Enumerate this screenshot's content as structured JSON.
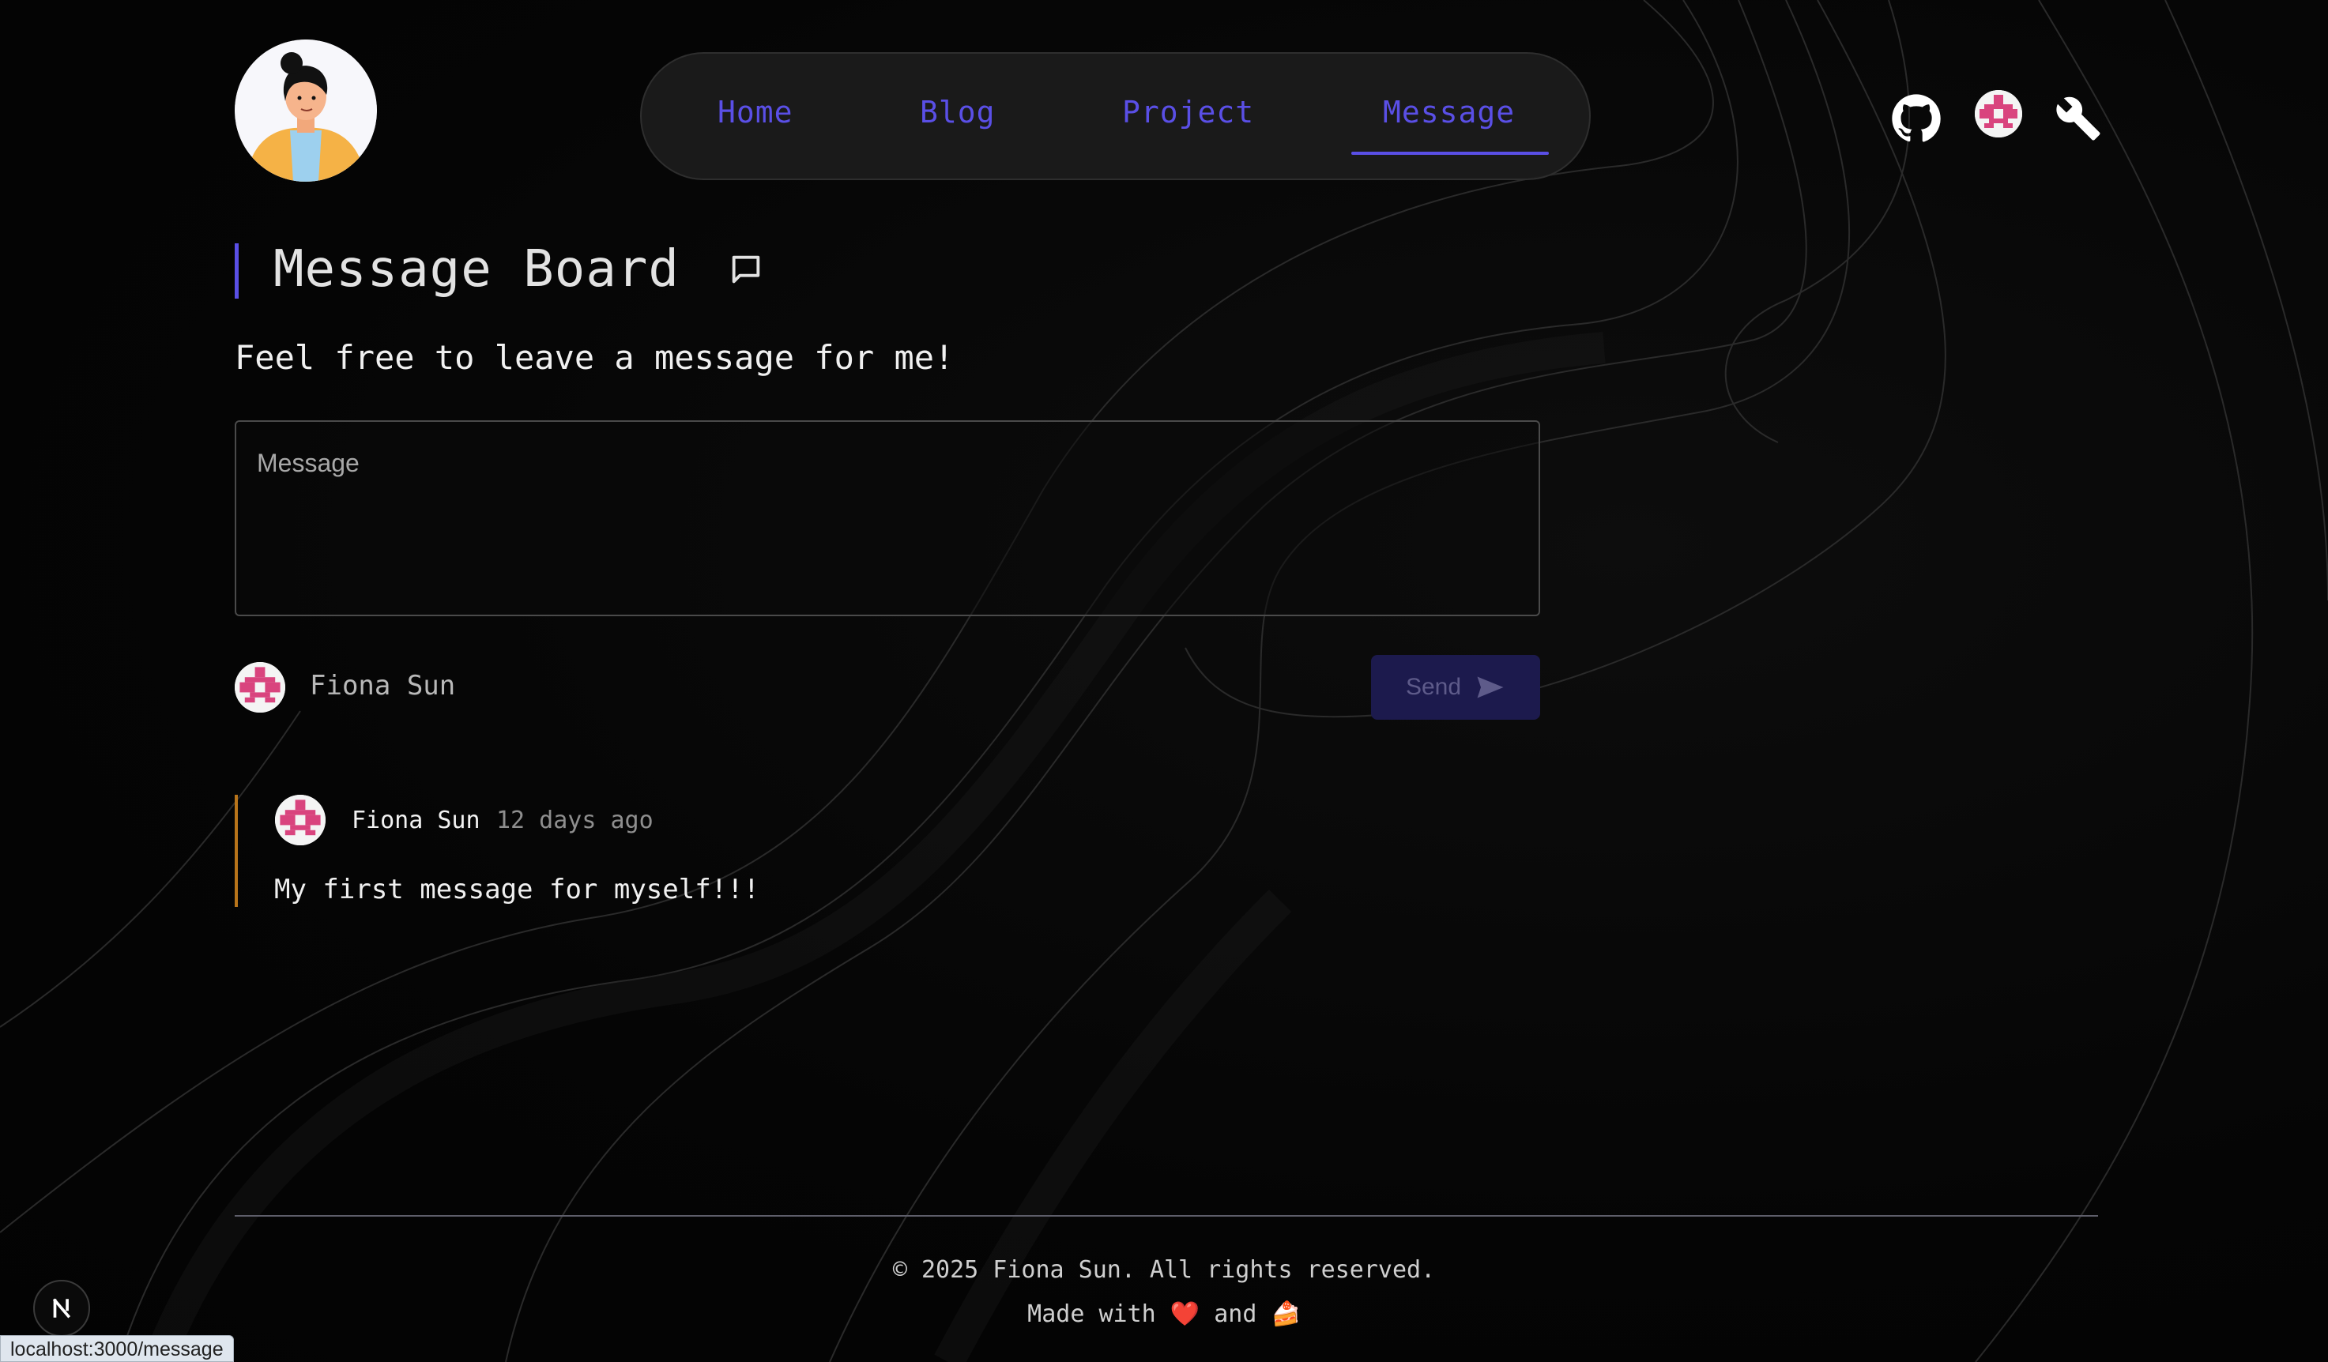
{
  "nav": {
    "items": [
      {
        "label": "Home"
      },
      {
        "label": "Blog"
      },
      {
        "label": "Project"
      },
      {
        "label": "Message"
      }
    ],
    "active": "Message",
    "active_color": "#5a4fe6"
  },
  "header_icons": [
    "github-icon",
    "user-avatar-icon",
    "wrench-icon"
  ],
  "page": {
    "title": "Message Board",
    "title_icon": "chat-bubble-icon",
    "subtitle": "Feel free to leave a message for me!"
  },
  "composer": {
    "placeholder": "Message",
    "value": "",
    "user_name": "Fiona Sun",
    "send_label": "Send",
    "send_icon": "send-icon"
  },
  "messages": [
    {
      "author": "Fiona Sun",
      "time": "12 days ago",
      "text": "My first message for myself!!!"
    }
  ],
  "footer": {
    "copyright": "© 2025 Fiona Sun. All rights reserved.",
    "made_with_prefix": "Made with",
    "made_with_and": "and",
    "heart": "❤️",
    "cake": "🍰"
  },
  "status_bar": {
    "url": "localhost:3000/message"
  },
  "colors": {
    "accent": "#5a4fe6",
    "message_bar": "#b8741a",
    "avatar_pink": "#d9447e",
    "background": "#050505"
  }
}
